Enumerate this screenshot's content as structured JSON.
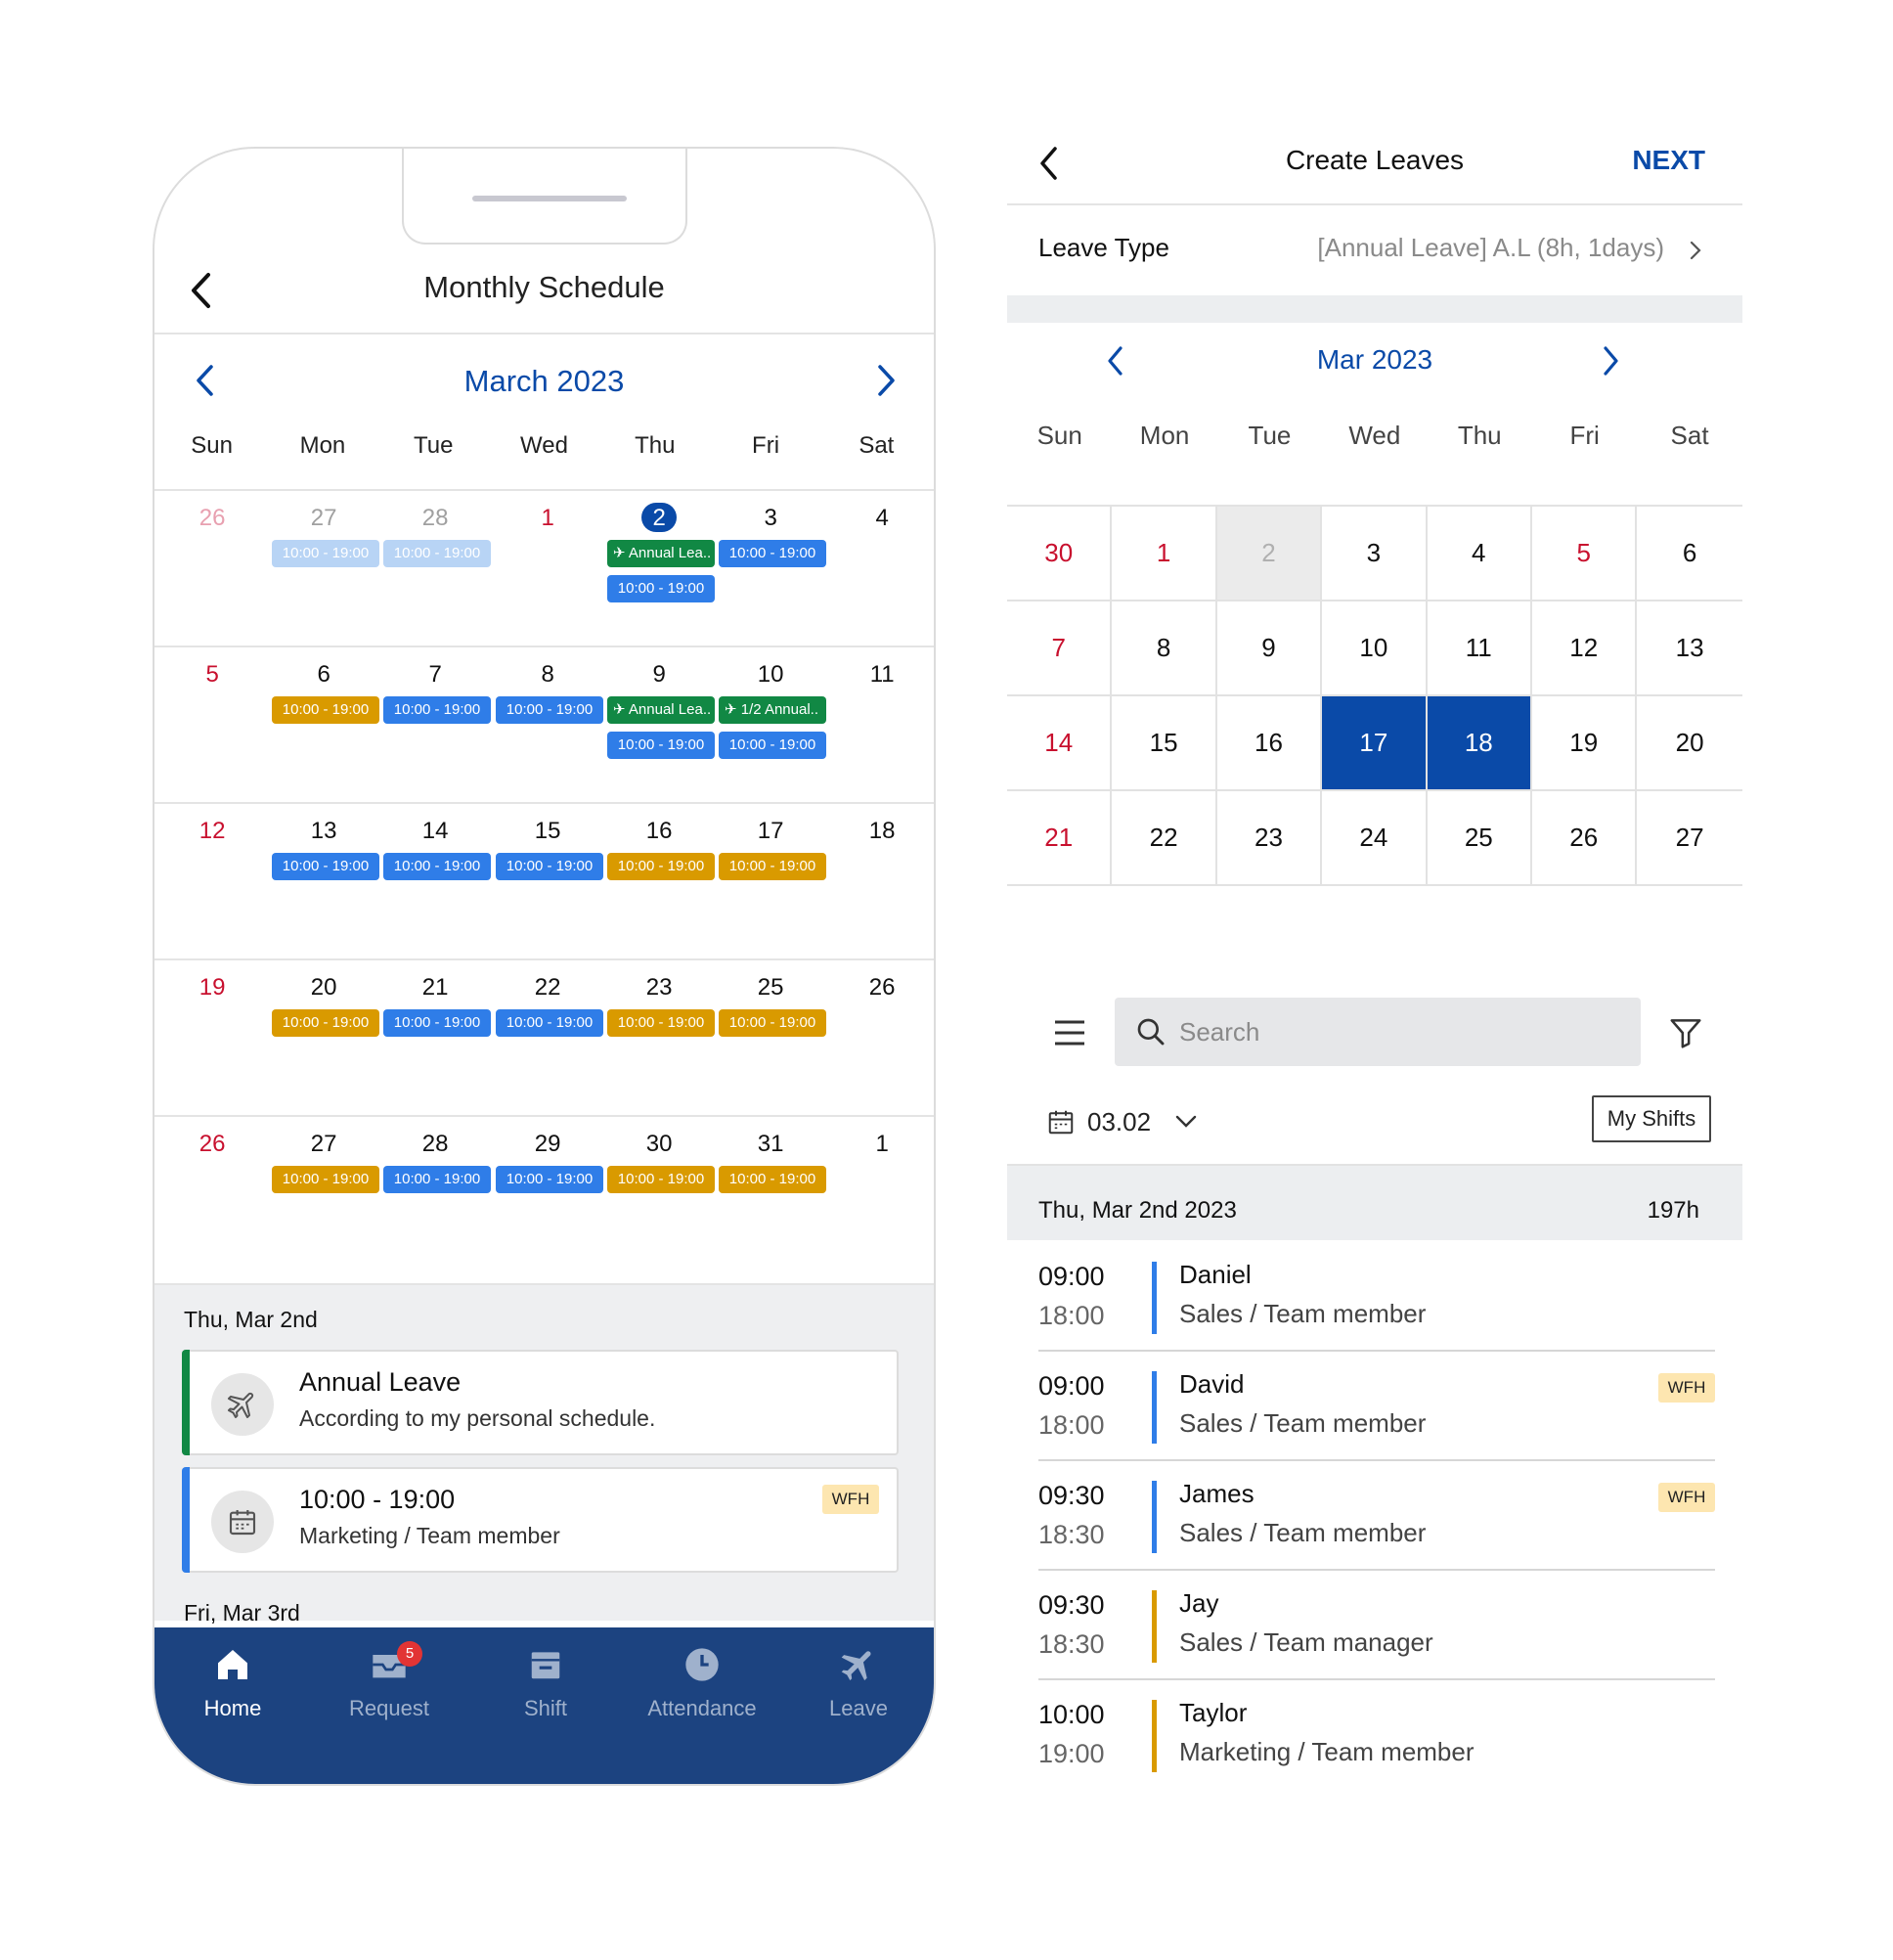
{
  "colors": {
    "primary": "#0a4aa8",
    "tabbar": "#1c4380",
    "shift_blue": "#2f7de8",
    "shift_gold": "#d99a00",
    "leave_green": "#118844",
    "sunday_red": "#c8102e",
    "wfh_bg": "#fde6b0"
  },
  "phone": {
    "title": "Monthly Schedule",
    "month": "March 2023",
    "weekdays": [
      "Sun",
      "Mon",
      "Tue",
      "Wed",
      "Thu",
      "Fri",
      "Sat"
    ],
    "weeks": [
      {
        "days": [
          "26",
          "27",
          "28",
          "1",
          "2",
          "3",
          "4"
        ]
      },
      {
        "days": [
          "5",
          "6",
          "7",
          "8",
          "9",
          "10",
          "11"
        ]
      },
      {
        "days": [
          "12",
          "13",
          "14",
          "15",
          "16",
          "17",
          "18"
        ]
      },
      {
        "days": [
          "19",
          "20",
          "21",
          "22",
          "23",
          "25",
          "26"
        ]
      },
      {
        "days": [
          "26",
          "27",
          "28",
          "29",
          "30",
          "31",
          "1"
        ]
      }
    ],
    "shift_time": "10:00 - 19:00",
    "leave_chip": "Annual Lea..",
    "half_leave_chip": "1/2 Annual..",
    "selected_date": "Thu, Mar 2nd",
    "events": [
      {
        "title": "Annual Leave",
        "subtitle": "According to my personal schedule.",
        "icon": "airplane-icon",
        "color": "#118844"
      },
      {
        "title": "10:00 - 19:00",
        "subtitle": "Marketing / Team member",
        "badge": "WFH",
        "icon": "calendar-icon",
        "color": "#2f7de8"
      }
    ],
    "next_date": "Fri, Mar 3rd",
    "tabs": [
      {
        "label": "Home",
        "icon": "home-icon",
        "active": true
      },
      {
        "label": "Request",
        "icon": "inbox-icon",
        "badge": "5"
      },
      {
        "label": "Shift",
        "icon": "shift-icon"
      },
      {
        "label": "Attendance",
        "icon": "clock-icon"
      },
      {
        "label": "Leave",
        "icon": "airplane-icon"
      }
    ]
  },
  "leave": {
    "title": "Create Leaves",
    "next": "NEXT",
    "leave_type_label": "Leave Type",
    "leave_type_value": "[Annual Leave] A.L (8h, 1days)",
    "month": "Mar 2023",
    "weekdays": [
      "Sun",
      "Mon",
      "Tue",
      "Wed",
      "Thu",
      "Fri",
      "Sat"
    ],
    "rows": [
      [
        "30",
        "1",
        "2",
        "3",
        "4",
        "5",
        "6"
      ],
      [
        "7",
        "8",
        "9",
        "10",
        "11",
        "12",
        "13"
      ],
      [
        "14",
        "15",
        "16",
        "17",
        "18",
        "19",
        "20"
      ],
      [
        "21",
        "22",
        "23",
        "24",
        "25",
        "26",
        "27"
      ]
    ],
    "selected_days": [
      "17",
      "18"
    ],
    "disabled_days": [
      "2"
    ],
    "search_placeholder": "Search",
    "filter_date": "03.02",
    "my_shifts": "My Shifts",
    "day_header": "Thu, Mar 2nd 2023",
    "day_total": "197h",
    "shifts": [
      {
        "start": "09:00",
        "end": "18:00",
        "name": "Daniel",
        "role": "Sales / Team member",
        "color": "#2f7de8"
      },
      {
        "start": "09:00",
        "end": "18:00",
        "name": "David",
        "role": "Sales / Team member",
        "color": "#2f7de8",
        "badge": "WFH"
      },
      {
        "start": "09:30",
        "end": "18:30",
        "name": "James",
        "role": "Sales / Team member",
        "color": "#2f7de8",
        "badge": "WFH"
      },
      {
        "start": "09:30",
        "end": "18:30",
        "name": "Jay",
        "role": "Sales / Team manager",
        "color": "#d99a00"
      },
      {
        "start": "10:00",
        "end": "19:00",
        "name": "Taylor",
        "role": "Marketing / Team member",
        "color": "#d99a00"
      }
    ]
  }
}
